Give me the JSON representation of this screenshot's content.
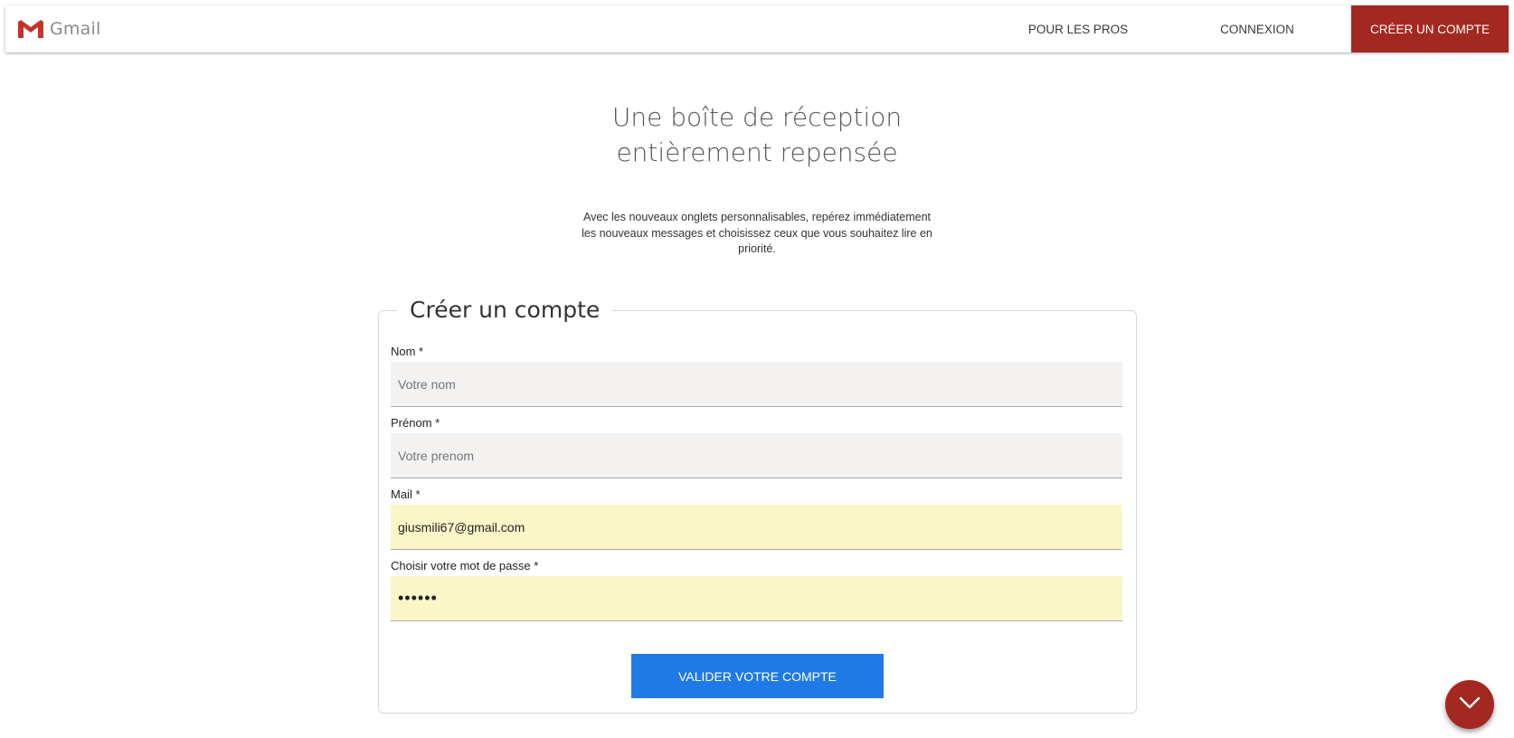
{
  "app": {
    "brand_name": "Gmail",
    "logo_icon": "gmail-m-logo-icon",
    "accent_color": "#a3281f",
    "button_color": "#1f7ae8",
    "autofill_color": "#fbf6c8"
  },
  "nav": {
    "pros_label": "POUR LES PROS",
    "login_label": "CONNEXION",
    "create_label": "CRÉER UN COMPTE"
  },
  "hero": {
    "title_line1": "Une boîte de réception",
    "title_line2": "entièrement repensée",
    "text": "Avec les nouveaux onglets personnalisables, repérez immédiatement les nouveaux messages et choisissez ceux que vous souhaitez lire en priorité."
  },
  "form": {
    "legend": "Créer un compte",
    "nom": {
      "label": "Nom *",
      "value": "",
      "placeholder": "Votre nom"
    },
    "prenom": {
      "label": "Prénom *",
      "value": "",
      "placeholder": "Votre prenom"
    },
    "mail": {
      "label": "Mail *",
      "value": "giusmili67@gmail.com",
      "placeholder": ""
    },
    "password": {
      "label": "Choisir votre mot de passe *",
      "value": "••••••"
    },
    "submit_label": "VALIDER VOTRE COMPTE"
  },
  "scroll_button": {
    "icon": "chevron-down-icon"
  }
}
